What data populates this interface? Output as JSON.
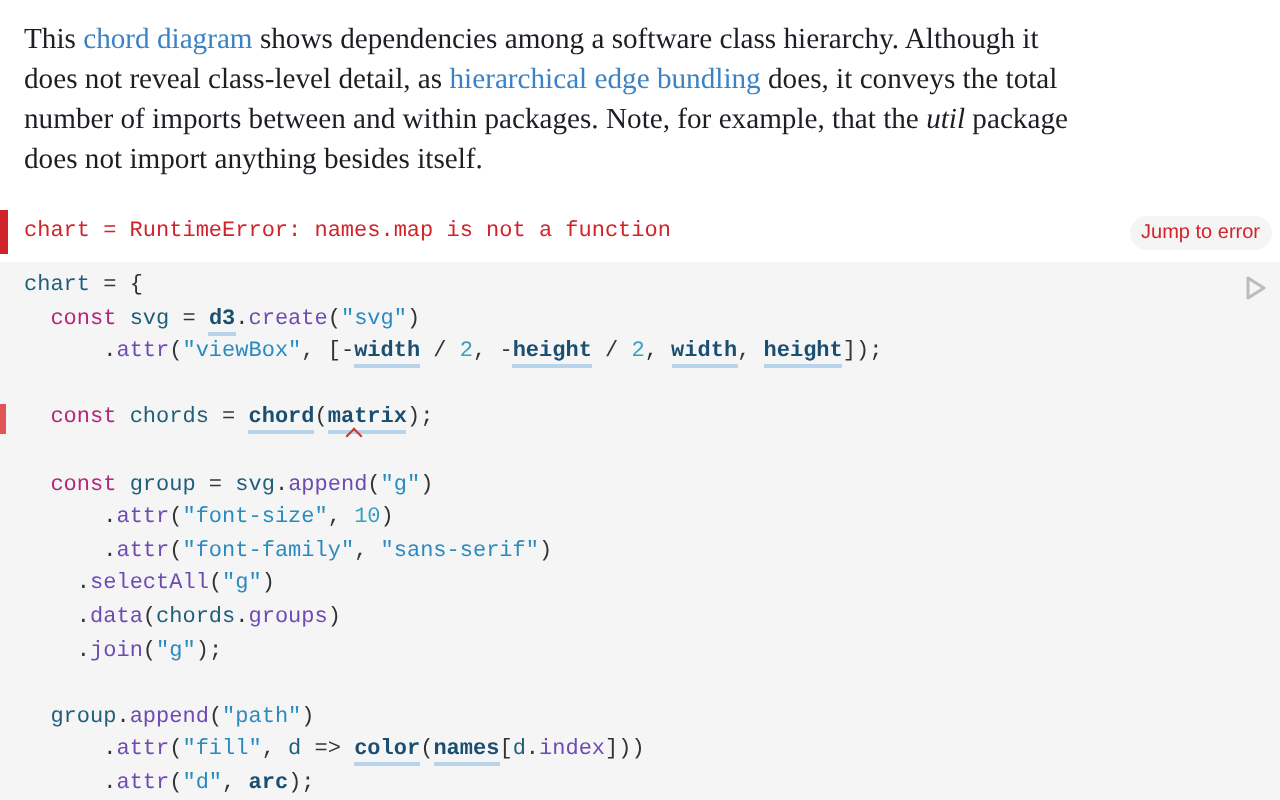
{
  "intro": [
    {
      "kind": "text",
      "text": "This "
    },
    {
      "kind": "link",
      "text": "chord diagram"
    },
    {
      "kind": "text",
      "text": " shows dependencies among a software class hierarchy. Although it does not reveal class-level detail, as "
    },
    {
      "kind": "link",
      "text": "hierarchical edge bundling"
    },
    {
      "kind": "text",
      "text": " does, it conveys the total number of imports between and within packages. Note, for example, that the *util* package does not import anything besides itself."
    }
  ],
  "error": {
    "message": "chart = RuntimeError: names.map is not a function",
    "button": "Jump to error"
  },
  "code": [
    {
      "marked": false,
      "tokens": [
        {
          "kind": "name",
          "text": "chart"
        },
        {
          "kind": "punct",
          "text": " = {"
        }
      ]
    },
    {
      "marked": false,
      "tokens": [
        {
          "kind": "keyword",
          "text": "  const"
        },
        {
          "kind": "name",
          "text": " svg"
        },
        {
          "kind": "punct",
          "text": " = "
        },
        {
          "kind": "ref",
          "text": "d3"
        },
        {
          "kind": "punct",
          "text": "."
        },
        {
          "kind": "method",
          "text": "create"
        },
        {
          "kind": "punct",
          "text": "("
        },
        {
          "kind": "string",
          "text": "\"svg\""
        },
        {
          "kind": "punct",
          "text": ")"
        }
      ]
    },
    {
      "marked": false,
      "tokens": [
        {
          "kind": "punct",
          "text": "      ."
        },
        {
          "kind": "method",
          "text": "attr"
        },
        {
          "kind": "punct",
          "text": "("
        },
        {
          "kind": "string",
          "text": "\"viewBox\""
        },
        {
          "kind": "punct",
          "text": ", [-"
        },
        {
          "kind": "ref",
          "text": "width"
        },
        {
          "kind": "punct",
          "text": " / "
        },
        {
          "kind": "number",
          "text": "2"
        },
        {
          "kind": "punct",
          "text": ", -"
        },
        {
          "kind": "ref",
          "text": "height"
        },
        {
          "kind": "punct",
          "text": " / "
        },
        {
          "kind": "number",
          "text": "2"
        },
        {
          "kind": "punct",
          "text": ", "
        },
        {
          "kind": "ref",
          "text": "width"
        },
        {
          "kind": "punct",
          "text": ", "
        },
        {
          "kind": "ref",
          "text": "height"
        },
        {
          "kind": "punct",
          "text": "]);"
        }
      ]
    },
    {
      "marked": false
    },
    {
      "marked": true,
      "tokens": [
        {
          "kind": "keyword",
          "text": "  const"
        },
        {
          "kind": "name",
          "text": " chords"
        },
        {
          "kind": "punct",
          "text": " = "
        },
        {
          "kind": "ref",
          "text": "chord"
        },
        {
          "kind": "punct",
          "text": "("
        },
        {
          "kind": "ref-error",
          "text": "matrix"
        },
        {
          "kind": "punct",
          "text": ");"
        }
      ]
    },
    {
      "marked": false
    },
    {
      "marked": false,
      "tokens": [
        {
          "kind": "keyword",
          "text": "  const"
        },
        {
          "kind": "name",
          "text": " group"
        },
        {
          "kind": "punct",
          "text": " = "
        },
        {
          "kind": "name",
          "text": "svg"
        },
        {
          "kind": "punct",
          "text": "."
        },
        {
          "kind": "method",
          "text": "append"
        },
        {
          "kind": "punct",
          "text": "("
        },
        {
          "kind": "string",
          "text": "\"g\""
        },
        {
          "kind": "punct",
          "text": ")"
        }
      ]
    },
    {
      "marked": false,
      "tokens": [
        {
          "kind": "punct",
          "text": "      ."
        },
        {
          "kind": "method",
          "text": "attr"
        },
        {
          "kind": "punct",
          "text": "("
        },
        {
          "kind": "string",
          "text": "\"font-size\""
        },
        {
          "kind": "punct",
          "text": ", "
        },
        {
          "kind": "number",
          "text": "10"
        },
        {
          "kind": "punct",
          "text": ")"
        }
      ]
    },
    {
      "marked": false,
      "tokens": [
        {
          "kind": "punct",
          "text": "      ."
        },
        {
          "kind": "method",
          "text": "attr"
        },
        {
          "kind": "punct",
          "text": "("
        },
        {
          "kind": "string",
          "text": "\"font-family\""
        },
        {
          "kind": "punct",
          "text": ", "
        },
        {
          "kind": "string",
          "text": "\"sans-serif\""
        },
        {
          "kind": "punct",
          "text": ")"
        }
      ]
    },
    {
      "marked": false,
      "tokens": [
        {
          "kind": "punct",
          "text": "    ."
        },
        {
          "kind": "method",
          "text": "selectAll"
        },
        {
          "kind": "punct",
          "text": "("
        },
        {
          "kind": "string",
          "text": "\"g\""
        },
        {
          "kind": "punct",
          "text": ")"
        }
      ]
    },
    {
      "marked": false,
      "tokens": [
        {
          "kind": "punct",
          "text": "    ."
        },
        {
          "kind": "method",
          "text": "data"
        },
        {
          "kind": "punct",
          "text": "("
        },
        {
          "kind": "name",
          "text": "chords"
        },
        {
          "kind": "punct",
          "text": "."
        },
        {
          "kind": "method",
          "text": "groups"
        },
        {
          "kind": "punct",
          "text": ")"
        }
      ]
    },
    {
      "marked": false,
      "tokens": [
        {
          "kind": "punct",
          "text": "    ."
        },
        {
          "kind": "method",
          "text": "join"
        },
        {
          "kind": "punct",
          "text": "("
        },
        {
          "kind": "string",
          "text": "\"g\""
        },
        {
          "kind": "punct",
          "text": ");"
        }
      ]
    },
    {
      "marked": false
    },
    {
      "marked": false,
      "tokens": [
        {
          "kind": "name",
          "text": "  group"
        },
        {
          "kind": "punct",
          "text": "."
        },
        {
          "kind": "method",
          "text": "append"
        },
        {
          "kind": "punct",
          "text": "("
        },
        {
          "kind": "string",
          "text": "\"path\""
        },
        {
          "kind": "punct",
          "text": ")"
        }
      ]
    },
    {
      "marked": false,
      "tokens": [
        {
          "kind": "punct",
          "text": "      ."
        },
        {
          "kind": "method",
          "text": "attr"
        },
        {
          "kind": "punct",
          "text": "("
        },
        {
          "kind": "string",
          "text": "\"fill\""
        },
        {
          "kind": "punct",
          "text": ", "
        },
        {
          "kind": "name",
          "text": "d"
        },
        {
          "kind": "punct",
          "text": " => "
        },
        {
          "kind": "ref",
          "text": "color"
        },
        {
          "kind": "punct",
          "text": "("
        },
        {
          "kind": "ref",
          "text": "names"
        },
        {
          "kind": "punct",
          "text": "["
        },
        {
          "kind": "name",
          "text": "d"
        },
        {
          "kind": "punct",
          "text": "."
        },
        {
          "kind": "method",
          "text": "index"
        },
        {
          "kind": "punct",
          "text": "]))"
        }
      ]
    },
    {
      "marked": false,
      "tokens": [
        {
          "kind": "punct",
          "text": "      ."
        },
        {
          "kind": "method",
          "text": "attr"
        },
        {
          "kind": "punct",
          "text": "("
        },
        {
          "kind": "string",
          "text": "\"d\""
        },
        {
          "kind": "punct",
          "text": ", "
        },
        {
          "kind": "bold",
          "text": "arc"
        },
        {
          "kind": "punct",
          "text": ");"
        }
      ]
    }
  ]
}
